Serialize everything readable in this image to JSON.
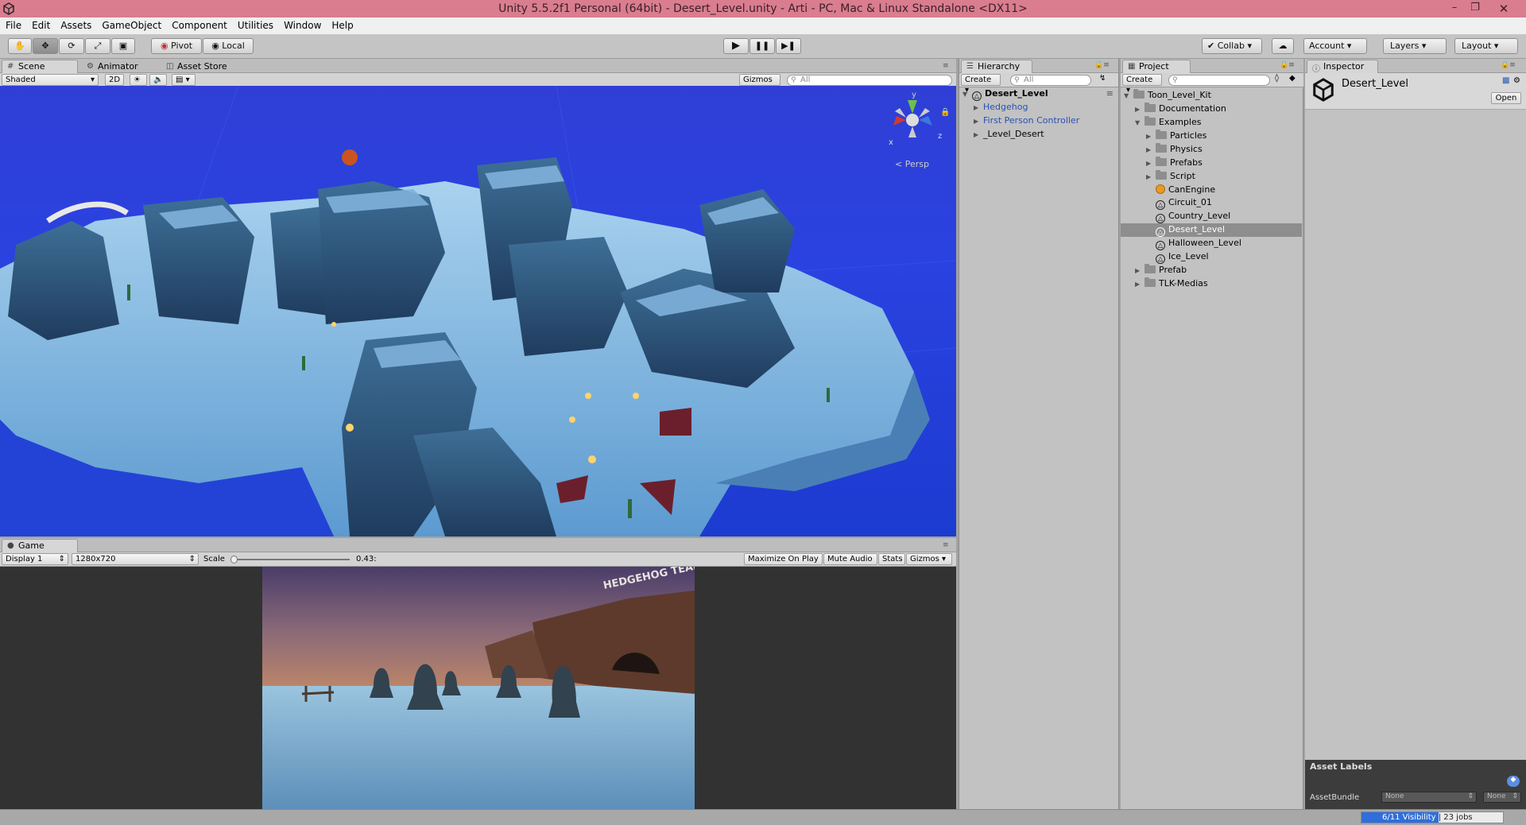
{
  "window": {
    "title": "Unity 5.5.2f1 Personal (64bit) - Desert_Level.unity - Arti - PC, Mac & Linux Standalone <DX11>"
  },
  "menu": [
    "File",
    "Edit",
    "Assets",
    "GameObject",
    "Component",
    "Utilities",
    "Window",
    "Help"
  ],
  "toolbar": {
    "pivot": "Pivot",
    "local": "Local",
    "collab": "Collab",
    "account": "Account",
    "layers": "Layers",
    "layout": "Layout"
  },
  "scene": {
    "tabs": [
      "Scene",
      "Animator",
      "Asset Store"
    ],
    "shading": "Shaded",
    "mode_2d": "2D",
    "gizmos": "Gizmos",
    "search_placeholder": "All",
    "persp": "Persp",
    "axis_y": "y",
    "axis_z": "z",
    "axis_x": "x",
    "sky_color": "#2a42e0"
  },
  "game": {
    "tab": "Game",
    "display": "Display 1",
    "resolution": "1280x720",
    "scale_label": "Scale",
    "scale_value": "0.43:",
    "scale_level": 0.43,
    "maximize": "Maximize On Play",
    "mute": "Mute Audio",
    "stats": "Stats",
    "gizmos": "Gizmos",
    "sign_text": "HEDGEHOG TEAM"
  },
  "hierarchy": {
    "tab": "Hierarchy",
    "create": "Create",
    "search_placeholder": "All",
    "scene_name": "Desert_Level",
    "items": [
      "Hedgehog",
      "First Person Controller",
      "_Level_Desert"
    ]
  },
  "project": {
    "tab": "Project",
    "create": "Create",
    "root": "Toon_Level_Kit",
    "documentation": "Documentation",
    "examples": "Examples",
    "example_folders": [
      "Particles",
      "Physics",
      "Prefabs",
      "Script"
    ],
    "example_assets": [
      "CanEngine",
      "Circuit_01",
      "Country_Level",
      "Desert_Level",
      "Halloween_Level",
      "Ice_Level"
    ],
    "selected": "Desert_Level",
    "bottom_folders": [
      "Prefab",
      "TLK-Medias"
    ]
  },
  "inspector": {
    "tab": "Inspector",
    "asset_name": "Desert_Level",
    "open": "Open",
    "asset_labels": "Asset Labels",
    "asset_bundle": "AssetBundle",
    "none1": "None",
    "none2": "None"
  },
  "status": {
    "visibility": "6/11 Visibility",
    "jobs": "| 23 jobs"
  }
}
